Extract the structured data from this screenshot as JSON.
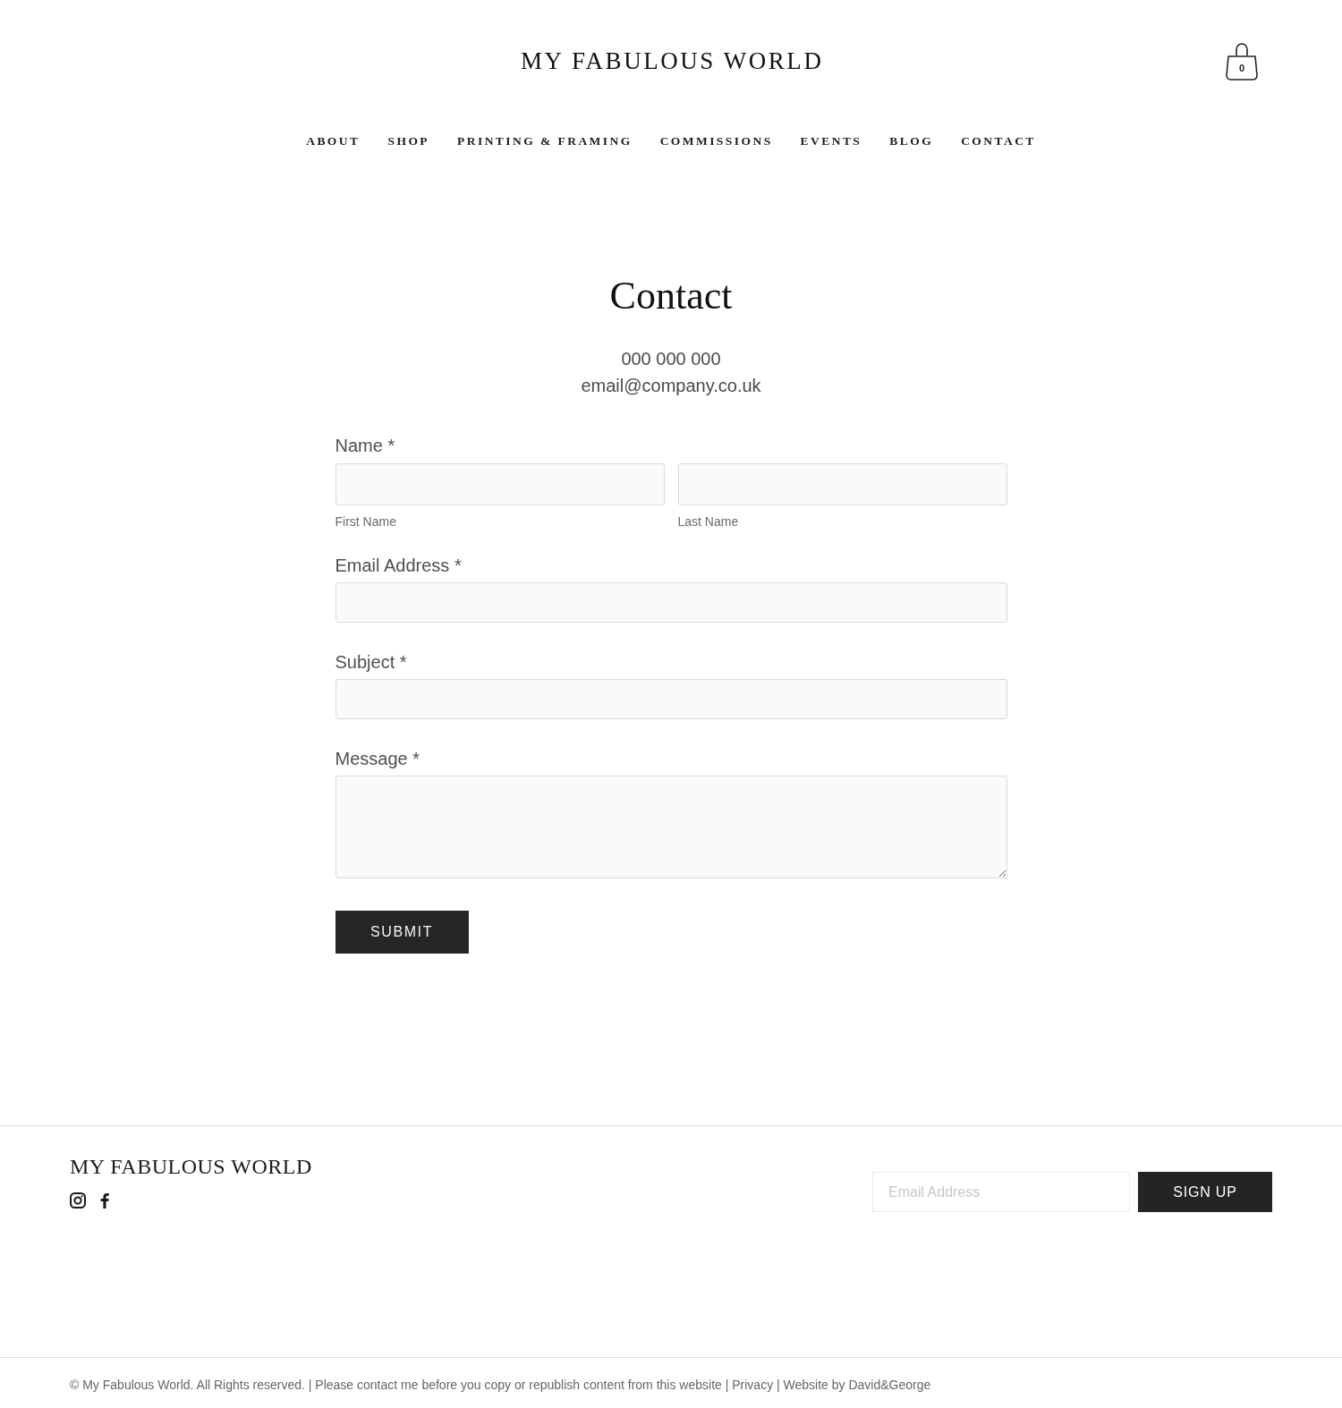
{
  "header": {
    "logo": "MY FABULOUS WORLD",
    "cart": {
      "count": "0"
    }
  },
  "nav": [
    "ABOUT",
    "SHOP",
    "PRINTING & FRAMING",
    "COMMISSIONS",
    "EVENTS",
    "BLOG",
    "CONTACT"
  ],
  "page": {
    "title": "Contact",
    "phone": "000 000 000",
    "email": "email@company.co.uk"
  },
  "form": {
    "fields": [
      {
        "kind": "split",
        "label": "Name *",
        "parts": [
          {
            "caption": "First Name"
          },
          {
            "caption": "Last Name"
          }
        ]
      },
      {
        "kind": "line",
        "label": "Email Address *"
      },
      {
        "kind": "line",
        "label": "Subject *"
      },
      {
        "kind": "multiline",
        "label": "Message *"
      }
    ],
    "submit": "SUBMIT"
  },
  "footer": {
    "logo": "MY FABULOUS WORLD",
    "social": [
      {
        "kind": "instagram"
      },
      {
        "kind": "facebook"
      }
    ],
    "newsletter": {
      "placeholder": "Email Address",
      "button": "SIGN UP"
    },
    "legal": {
      "notice": "© My Fabulous World. All Rights reserved. | Please contact me before you copy or republish content from this website |",
      "privacy_link": "Privacy",
      "separator": "|",
      "credit_link": "Website by David&George"
    }
  }
}
